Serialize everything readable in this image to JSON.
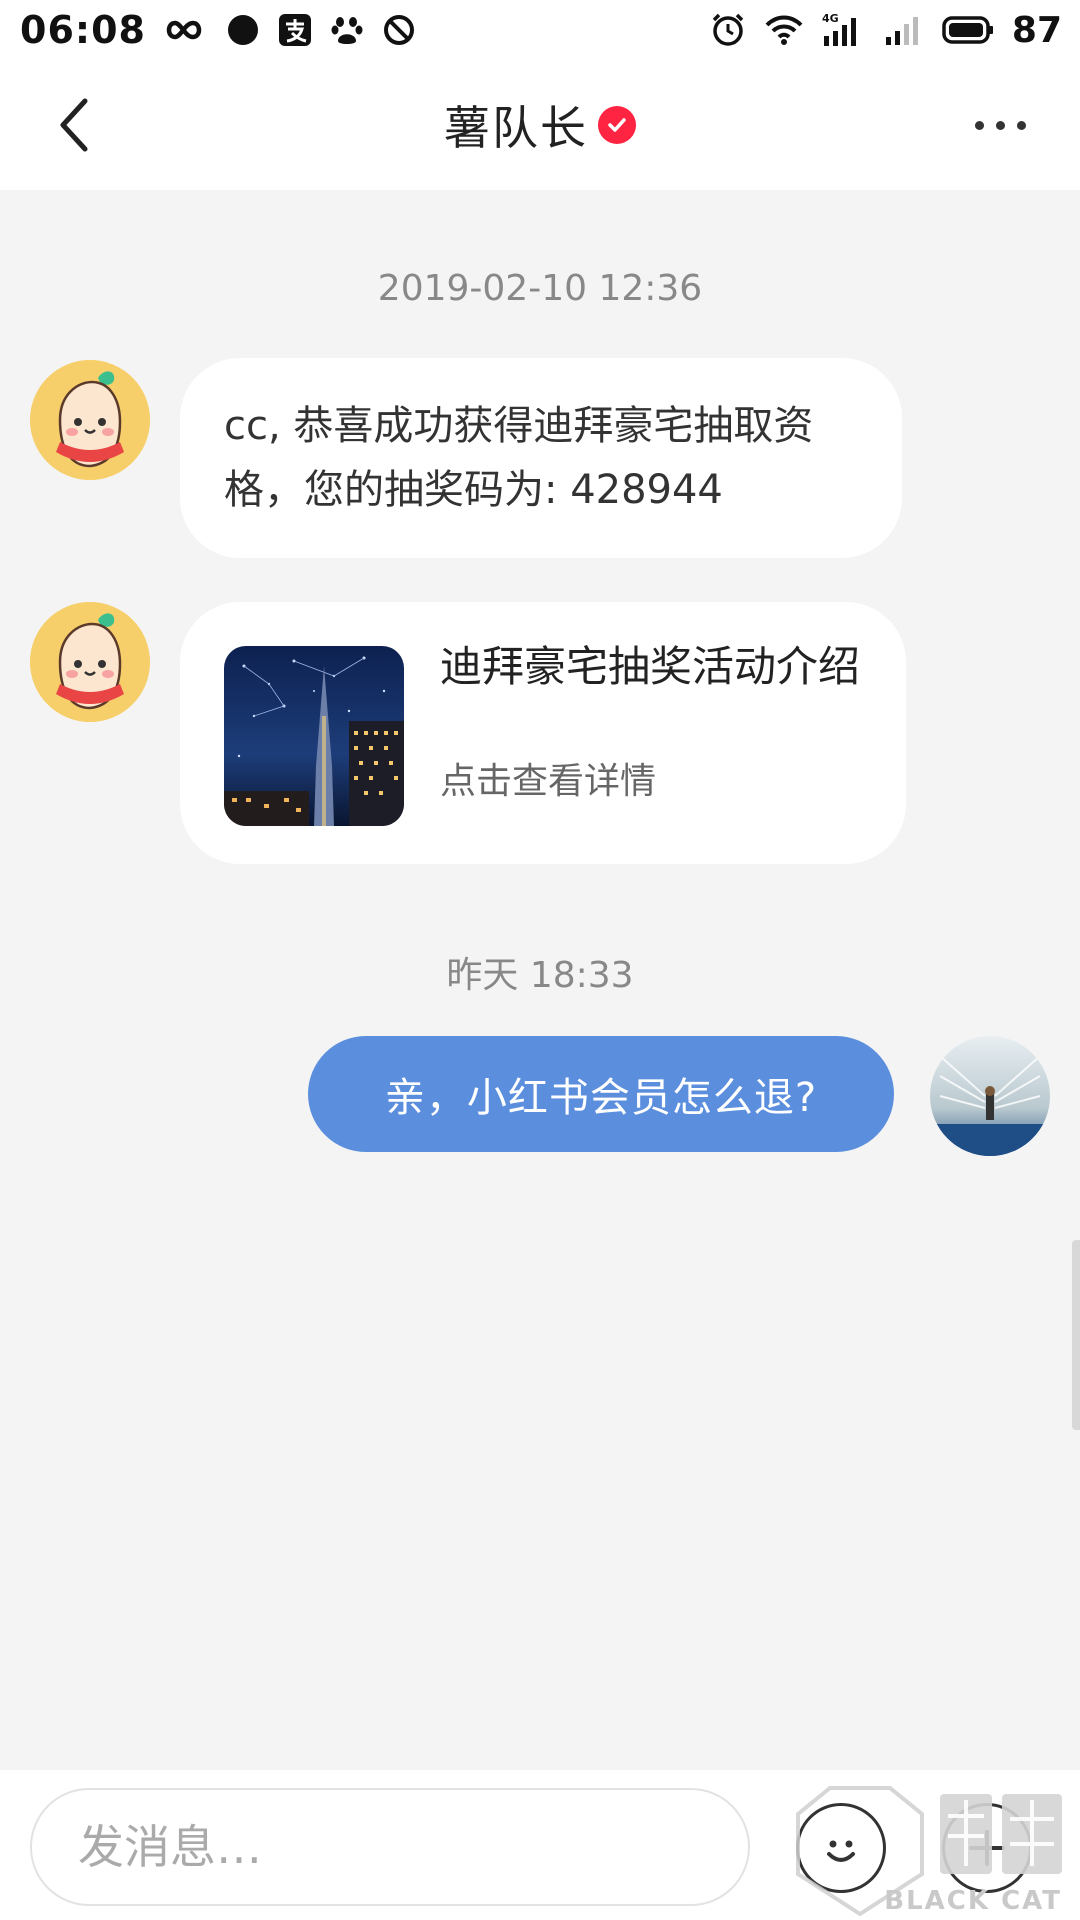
{
  "status_bar": {
    "time": "06:08",
    "battery": "87",
    "network_badge": "4G",
    "left_icons": [
      "infinity-icon",
      "chat-bubble-icon",
      "alipay-icon",
      "baidu-paw-icon",
      "dnd-icon"
    ],
    "right_icons": [
      "alarm-icon",
      "wifi-icon",
      "signal-4g-icon",
      "signal-icon",
      "battery-icon"
    ]
  },
  "header": {
    "title": "薯队长",
    "verified": true,
    "accent_color": "#ff2442"
  },
  "messages": [
    {
      "type": "timestamp",
      "text": "2019-02-10 12:36"
    },
    {
      "type": "text",
      "from": "other",
      "text": "cc, 恭喜成功获得迪拜豪宅抽取资格，您的抽奖码为: 428944"
    },
    {
      "type": "card",
      "from": "other",
      "title": "迪拜豪宅抽奖活动介绍",
      "subtitle": "点击查看详情"
    },
    {
      "type": "timestamp",
      "text": "昨天 18:33"
    },
    {
      "type": "text",
      "from": "me",
      "text": "亲，小红书会员怎么退?",
      "bubble_color": "#5b8fde"
    }
  ],
  "input_bar": {
    "placeholder": "发消息…"
  },
  "watermark": {
    "text": "BLACK CAT",
    "icon": "black-cat-logo-icon"
  }
}
